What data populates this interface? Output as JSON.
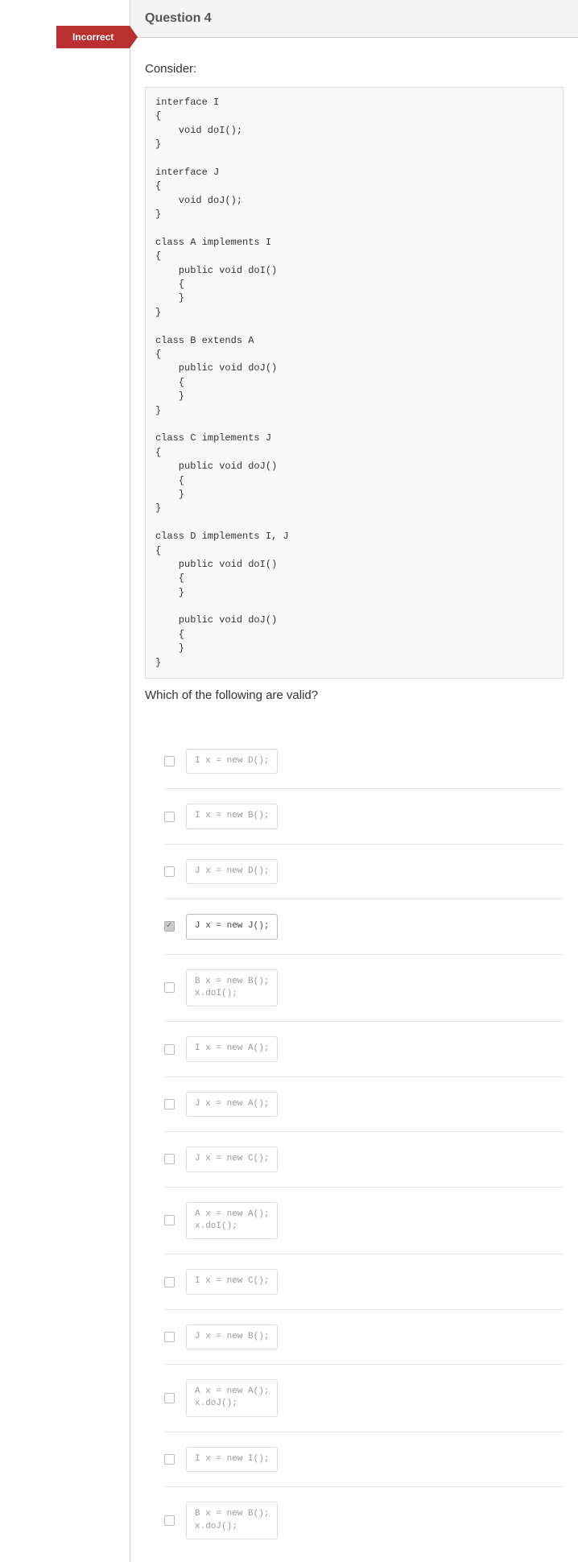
{
  "flag": "Incorrect",
  "header": "Question 4",
  "prompt": "Consider:",
  "code": "interface I\n{\n    void doI();\n}\n\ninterface J\n{\n    void doJ();\n}\n\nclass A implements I\n{\n    public void doI()\n    {\n    }\n}\n\nclass B extends A\n{\n    public void doJ()\n    {\n    }\n}\n\nclass C implements J\n{\n    public void doJ()\n    {\n    }\n}\n\nclass D implements I, J\n{\n    public void doI()\n    {\n    }\n\n    public void doJ()\n    {\n    }\n}",
  "follow": "Which of the following are valid?",
  "answers": [
    {
      "code": "I x = new D();",
      "checked": false
    },
    {
      "code": "I x = new B();",
      "checked": false
    },
    {
      "code": "J x = new D();",
      "checked": false
    },
    {
      "code": "J x = new J();",
      "checked": true
    },
    {
      "code": "B x = new B();\nx.doI();",
      "checked": false
    },
    {
      "code": "I x = new A();",
      "checked": false
    },
    {
      "code": "J x = new A();",
      "checked": false
    },
    {
      "code": "J x = new C();",
      "checked": false
    },
    {
      "code": "A x = new A();\nx.doI();",
      "checked": false
    },
    {
      "code": "I x = new C();",
      "checked": false
    },
    {
      "code": "J x = new B();",
      "checked": false
    },
    {
      "code": "A x = new A();\nx.doJ();",
      "checked": false
    },
    {
      "code": "I x = new I();",
      "checked": false
    },
    {
      "code": "B x = new B();\nx.doJ();",
      "checked": false
    }
  ]
}
